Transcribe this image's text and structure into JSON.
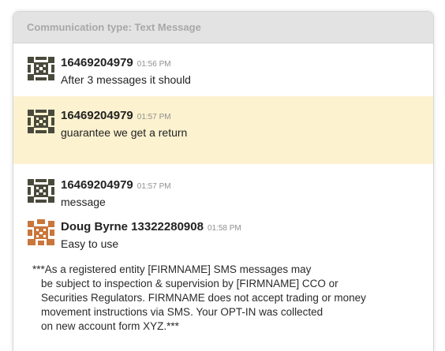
{
  "header": {
    "title": "Communication type: Text Message"
  },
  "messages": [
    {
      "sender": "16469204979",
      "time": "01:56 PM",
      "text": "After 3 messages it should",
      "avatar_icon": "sms-identicon-icon",
      "highlighted": false
    },
    {
      "sender": "16469204979",
      "time": "01:57 PM",
      "text": "guarantee we get a return",
      "avatar_icon": "sms-identicon-icon",
      "highlighted": true
    },
    {
      "sender": "16469204979",
      "time": "01:57 PM",
      "text": "message",
      "avatar_icon": "sms-identicon-icon",
      "highlighted": false
    },
    {
      "sender": "Doug Byrne 13322280908",
      "time": "01:58 PM",
      "text": "Easy to use",
      "avatar_icon": "user-identicon-icon",
      "highlighted": false
    }
  ],
  "disclaimer": {
    "lines": [
      "***As a registered entity [FIRMNAME] SMS messages may",
      "be subject to inspection & supervision by [FIRMNAME] CCO or",
      "Securities Regulators. FIRMNAME does not accept trading or money",
      "movement instructions via SMS. Your OPT-IN was collected",
      "on new account form XYZ.***"
    ]
  },
  "colors": {
    "highlight": "#fcf2cf",
    "header_bg": "#e3e3e3",
    "header_text": "#a8a8a8",
    "sms_avatar": "#4a4a3c",
    "user_avatar": "#c9763a"
  }
}
